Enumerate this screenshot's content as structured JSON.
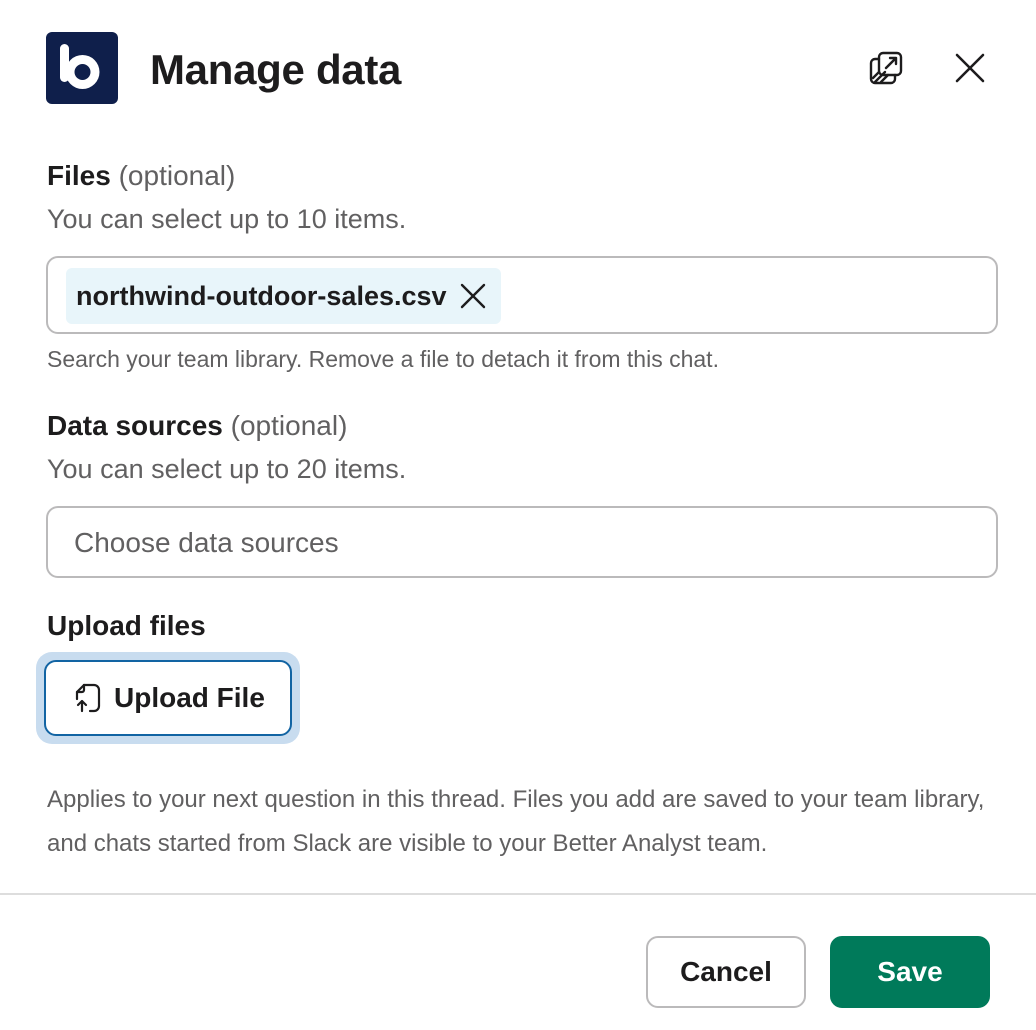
{
  "header": {
    "title": "Manage data",
    "logo_icon": "better-analyst-logo",
    "popout_icon": "popout-icon",
    "close_icon": "close-icon",
    "logo_color": "#0f1f4b"
  },
  "files": {
    "label": "Files",
    "optional": "(optional)",
    "hint": "You can select up to 10 items.",
    "selected": [
      "northwind-outdoor-sales.csv"
    ],
    "help": "Search your team library. Remove a file to detach it from this chat."
  },
  "data_sources": {
    "label": "Data sources",
    "optional": "(optional)",
    "hint": "You can select up to 20 items.",
    "placeholder": "Choose data sources"
  },
  "upload": {
    "label": "Upload files",
    "button_label": "Upload File",
    "button_icon": "file-upload-icon"
  },
  "note": "Applies to your next question in this thread. Files you add are saved to your team library, and chats started from Slack are visible to your Better Analyst team.",
  "footer": {
    "cancel_label": "Cancel",
    "save_label": "Save",
    "save_color": "#007a5a"
  }
}
